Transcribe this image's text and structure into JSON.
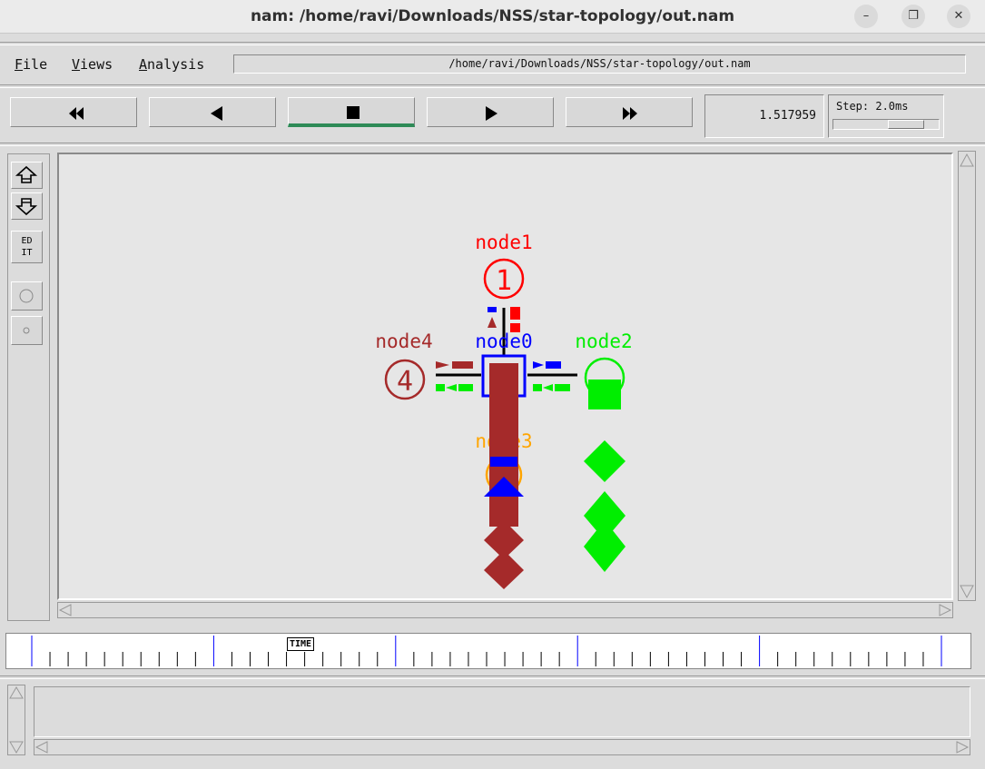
{
  "window": {
    "title": "nam: /home/ravi/Downloads/NSS/star-topology/out.nam",
    "minimize_glyph": "–",
    "maximize_glyph": "❐",
    "close_glyph": "✕"
  },
  "menu": {
    "file": "File",
    "views": "Views",
    "analysis": "Analysis",
    "path": "/home/ravi/Downloads/NSS/star-topology/out.nam"
  },
  "controls": {
    "rewind_icon": "rewind-icon",
    "back_icon": "step-back-icon",
    "stop_icon": "stop-icon",
    "play_icon": "play-icon",
    "fastforward_icon": "fast-forward-icon",
    "time": "1.517959",
    "step_label": "Step: 2.0ms"
  },
  "tools": {
    "zoom_in_icon": "zoom-in-icon",
    "zoom_out_icon": "zoom-out-icon",
    "edit_label_1": "ED",
    "edit_label_2": "IT",
    "circle_large_icon": "circle-icon",
    "circle_small_icon": "small-circle-icon"
  },
  "topology": {
    "nodes": [
      {
        "id": "0",
        "label": "node0",
        "color": "#0000ff",
        "shape": "square"
      },
      {
        "id": "1",
        "label": "node1",
        "color": "#ff0000",
        "shape": "circle"
      },
      {
        "id": "2",
        "label": "node2",
        "color": "#00ee00",
        "shape": "circle"
      },
      {
        "id": "3",
        "label": "node3",
        "color": "#ffa500",
        "shape": "circle"
      },
      {
        "id": "4",
        "label": "node4",
        "color": "#a52a2a",
        "shape": "circle"
      }
    ],
    "packet_colors": {
      "brown": "#a52a2a",
      "green": "#00ee00",
      "blue": "#0000ff",
      "red": "#ff0000"
    }
  },
  "timeline": {
    "marker_label": "TIME"
  }
}
